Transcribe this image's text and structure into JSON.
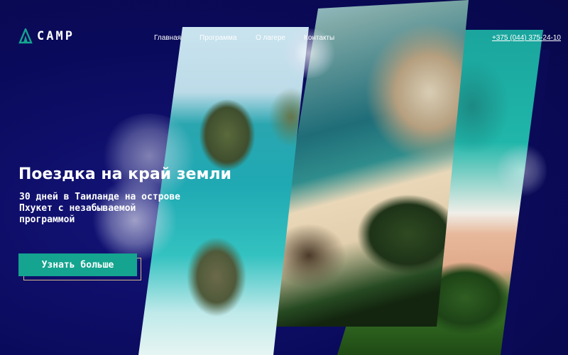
{
  "brand": {
    "logo_text": "CAMP",
    "accent": "#14a48f",
    "background": "#0a0a5c"
  },
  "nav": {
    "items": [
      "Главная",
      "Программа",
      "О лагере",
      "Контакты"
    ]
  },
  "contact": {
    "phone": "+375 (044) 375-24-10"
  },
  "hero": {
    "title": "Поездка на край земли",
    "subtitle": "30 дней в Таиланде на острове Пхукет с незабываемой программой",
    "cta_label": "Узнать больше"
  },
  "icons": {
    "logo": "tent-icon"
  }
}
